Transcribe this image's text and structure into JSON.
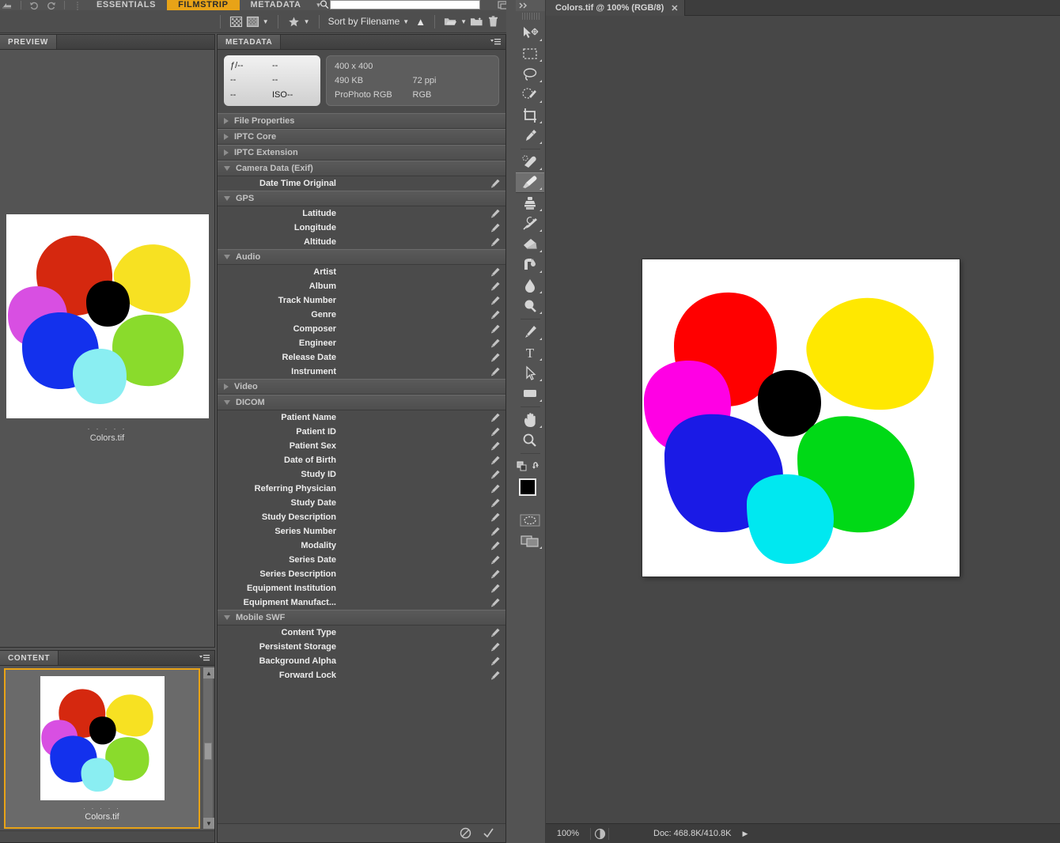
{
  "bridge": {
    "workspace_tabs": [
      {
        "label": "ESSENTIALS",
        "active": false
      },
      {
        "label": "FILMSTRIP",
        "active": true
      },
      {
        "label": "METADATA",
        "active": false
      }
    ],
    "search_placeholder": "",
    "toolbar": {
      "sort_label": "Sort by Filename",
      "filter_icon": "filter-icon",
      "rating_icon": "star-icon",
      "new_folder_icon": "new-folder-icon",
      "open_folder_icon": "open-folder-icon",
      "delete_icon": "trash-icon",
      "sort_direction_icon": "caret-up-icon"
    },
    "preview_panel": {
      "tab_label": "PREVIEW",
      "filename": "Colors.tif",
      "rating_dots": ". . . . ."
    },
    "content_panel": {
      "tab_label": "CONTENT",
      "filename": "Colors.tif",
      "rating_dots": ". . . . ."
    },
    "metadata_panel": {
      "tab_label": "METADATA",
      "camera_info": {
        "aperture": "ƒ/--",
        "shutter": "--",
        "focal": "--",
        "exposure": "--",
        "mode": "--",
        "iso": "ISO--"
      },
      "file_info": {
        "dimensions": "400 x 400",
        "filesize": "490 KB",
        "resolution": "72 ppi",
        "colorprofile": "ProPhoto RGB",
        "colormode": "RGB"
      },
      "sections": [
        {
          "title": "File Properties",
          "open": false,
          "rows": []
        },
        {
          "title": "IPTC Core",
          "open": false,
          "rows": []
        },
        {
          "title": "IPTC Extension",
          "open": false,
          "rows": []
        },
        {
          "title": "Camera Data (Exif)",
          "open": true,
          "rows": [
            {
              "label": "Date Time Original",
              "value": ""
            }
          ]
        },
        {
          "title": "GPS",
          "open": true,
          "rows": [
            {
              "label": "Latitude",
              "value": ""
            },
            {
              "label": "Longitude",
              "value": ""
            },
            {
              "label": "Altitude",
              "value": ""
            }
          ]
        },
        {
          "title": "Audio",
          "open": true,
          "rows": [
            {
              "label": "Artist",
              "value": ""
            },
            {
              "label": "Album",
              "value": ""
            },
            {
              "label": "Track Number",
              "value": ""
            },
            {
              "label": "Genre",
              "value": ""
            },
            {
              "label": "Composer",
              "value": ""
            },
            {
              "label": "Engineer",
              "value": ""
            },
            {
              "label": "Release Date",
              "value": ""
            },
            {
              "label": "Instrument",
              "value": ""
            }
          ]
        },
        {
          "title": "Video",
          "open": false,
          "rows": []
        },
        {
          "title": "DICOM",
          "open": true,
          "rows": [
            {
              "label": "Patient Name",
              "value": ""
            },
            {
              "label": "Patient ID",
              "value": ""
            },
            {
              "label": "Patient Sex",
              "value": ""
            },
            {
              "label": "Date of Birth",
              "value": ""
            },
            {
              "label": "Study ID",
              "value": ""
            },
            {
              "label": "Referring Physician",
              "value": ""
            },
            {
              "label": "Study Date",
              "value": ""
            },
            {
              "label": "Study Description",
              "value": ""
            },
            {
              "label": "Series Number",
              "value": ""
            },
            {
              "label": "Modality",
              "value": ""
            },
            {
              "label": "Series Date",
              "value": ""
            },
            {
              "label": "Series Description",
              "value": ""
            },
            {
              "label": "Equipment Institution",
              "value": ""
            },
            {
              "label": "Equipment Manufact...",
              "value": ""
            }
          ]
        },
        {
          "title": "Mobile SWF",
          "open": true,
          "rows": [
            {
              "label": "Content Type",
              "value": ""
            },
            {
              "label": "Persistent Storage",
              "value": ""
            },
            {
              "label": "Background Alpha",
              "value": ""
            },
            {
              "label": "Forward Lock",
              "value": ""
            }
          ]
        }
      ],
      "footer": {
        "cancel_icon": "cancel-icon",
        "apply_icon": "checkmark-icon"
      }
    }
  },
  "photoshop": {
    "document_tab": {
      "title": "Colors.tif @ 100% (RGB/8)",
      "close_icon": "close-icon"
    },
    "status_bar": {
      "zoom": "100%",
      "doc_info": "Doc: 468.8K/410.8K",
      "proof_icon": "proof-colors-icon",
      "expand_icon": "expand-arrow-icon"
    },
    "tools": [
      {
        "name": "move-tool",
        "selected": false
      },
      {
        "name": "rectangular-marquee-tool",
        "selected": false
      },
      {
        "name": "lasso-tool",
        "selected": false
      },
      {
        "name": "quick-selection-tool",
        "selected": false
      },
      {
        "name": "crop-tool",
        "selected": false
      },
      {
        "name": "eyedropper-tool",
        "selected": false
      },
      {
        "name": "healing-brush-tool",
        "selected": false
      },
      {
        "name": "brush-tool",
        "selected": true
      },
      {
        "name": "clone-stamp-tool",
        "selected": false
      },
      {
        "name": "history-brush-tool",
        "selected": false
      },
      {
        "name": "eraser-tool",
        "selected": false
      },
      {
        "name": "gradient-tool",
        "selected": false
      },
      {
        "name": "blur-tool",
        "selected": false
      },
      {
        "name": "dodge-tool",
        "selected": false
      },
      {
        "name": "pen-tool",
        "selected": false
      },
      {
        "name": "type-tool",
        "selected": false
      },
      {
        "name": "path-selection-tool",
        "selected": false
      },
      {
        "name": "rectangle-shape-tool",
        "selected": false
      },
      {
        "name": "hand-tool",
        "selected": false
      },
      {
        "name": "zoom-tool",
        "selected": false
      }
    ],
    "colors": {
      "foreground": "#000000",
      "background": "#ffffff"
    }
  },
  "artwork": {
    "canvas_blobs": [
      {
        "name": "red",
        "color": "#FF0000"
      },
      {
        "name": "yellow",
        "color": "#FFE800"
      },
      {
        "name": "magenta",
        "color": "#FF00E4"
      },
      {
        "name": "black",
        "color": "#000000"
      },
      {
        "name": "blue",
        "color": "#1A1AE6"
      },
      {
        "name": "green",
        "color": "#00D916"
      },
      {
        "name": "cyan",
        "color": "#00E8F0"
      }
    ],
    "preview_blobs": [
      {
        "name": "red",
        "color": "#D5280F"
      },
      {
        "name": "yellow",
        "color": "#F7E122"
      },
      {
        "name": "magenta",
        "color": "#D84FE2"
      },
      {
        "name": "black",
        "color": "#000000"
      },
      {
        "name": "blue",
        "color": "#1331ED"
      },
      {
        "name": "green",
        "color": "#8ADB2C"
      },
      {
        "name": "cyan",
        "color": "#8AEEF2"
      }
    ]
  }
}
